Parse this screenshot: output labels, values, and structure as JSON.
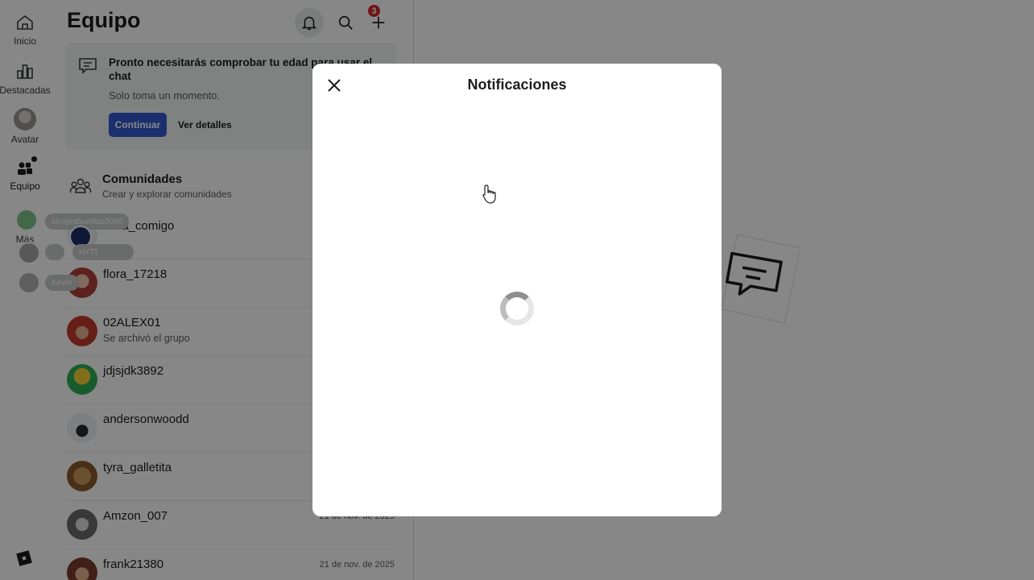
{
  "nav": {
    "items": [
      {
        "label": "Inicio",
        "icon": "home-icon"
      },
      {
        "label": "Destacadas",
        "icon": "charts-icon"
      },
      {
        "label": "Avatar",
        "icon": "avatar-icon"
      },
      {
        "label": "Equipo",
        "icon": "party-icon"
      },
      {
        "label": "Más",
        "icon": "more-icon"
      }
    ]
  },
  "header": {
    "title": "Equipo",
    "notification_count": "3"
  },
  "age_check": {
    "title": "Pronto necesitarás comprobar tu edad para usar el chat",
    "subtitle": "Solo toma un momento.",
    "continue_label": "Continuar",
    "details_label": "Ver detalles"
  },
  "communities": {
    "title": "Comunidades",
    "subtitle": "Crear y explorar comunidades"
  },
  "floating_tags": [
    "elcojeabuelitas3000",
    "...",
    "HYTL",
    "Kevin"
  ],
  "chats": [
    {
      "name": "casa_comigo",
      "subtitle": "",
      "date": ""
    },
    {
      "name": "flora_17218",
      "subtitle": "",
      "date": ""
    },
    {
      "name": "02ALEX01",
      "subtitle": "Se archivó el grupo",
      "date": ""
    },
    {
      "name": "jdjsjdk3892",
      "subtitle": "",
      "date": ""
    },
    {
      "name": "andersonwoodd",
      "subtitle": "",
      "date": ""
    },
    {
      "name": "tyra_galletita",
      "subtitle": "",
      "date": ""
    },
    {
      "name": "Amzon_007",
      "subtitle": "",
      "date": "21 de nov. de 2025"
    },
    {
      "name": "frank21380",
      "subtitle": "",
      "date": "21 de nov. de 2025"
    }
  ],
  "modal": {
    "title": "Notificaciones",
    "state": "loading"
  },
  "colors": {
    "accent": "#3359d2",
    "badge": "#d5262a",
    "overlay": "rgba(0,0,0,0.47)"
  }
}
